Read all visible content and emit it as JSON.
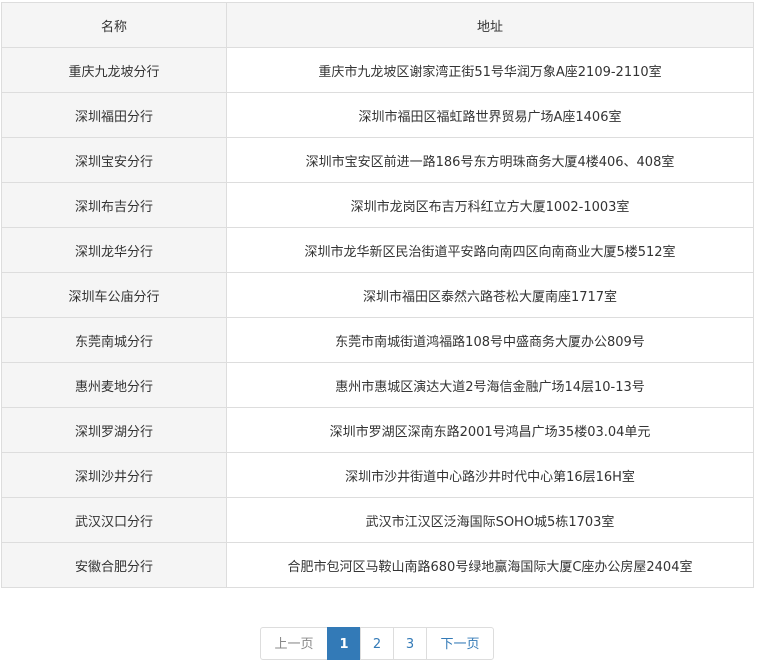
{
  "table": {
    "headers": {
      "name": "名称",
      "address": "地址"
    },
    "rows": [
      {
        "name": "重庆九龙坡分行",
        "address": "重庆市九龙坡区谢家湾正街51号华润万象A座2109-2110室"
      },
      {
        "name": "深圳福田分行",
        "address": "深圳市福田区福虹路世界贸易广场A座1406室"
      },
      {
        "name": "深圳宝安分行",
        "address": "深圳市宝安区前进一路186号东方明珠商务大厦4楼406、408室"
      },
      {
        "name": "深圳布吉分行",
        "address": "深圳市龙岗区布吉万科红立方大厦1002-1003室"
      },
      {
        "name": "深圳龙华分行",
        "address": "深圳市龙华新区民治街道平安路向南四区向南商业大厦5楼512室"
      },
      {
        "name": "深圳车公庙分行",
        "address": "深圳市福田区泰然六路苍松大厦南座1717室"
      },
      {
        "name": "东莞南城分行",
        "address": "东莞市南城街道鸿福路108号中盛商务大厦办公809号"
      },
      {
        "name": "惠州麦地分行",
        "address": "惠州市惠城区演达大道2号海信金融广场14层10-13号"
      },
      {
        "name": "深圳罗湖分行",
        "address": "深圳市罗湖区深南东路2001号鸿昌广场35楼03.04单元"
      },
      {
        "name": "深圳沙井分行",
        "address": "深圳市沙井街道中心路沙井时代中心第16层16H室"
      },
      {
        "name": "武汉汉口分行",
        "address": "武汉市江汉区泛海国际SOHO城5栋1703室"
      },
      {
        "name": "安徽合肥分行",
        "address": "合肥市包河区马鞍山南路680号绿地赢海国际大厦C座办公房屋2404室"
      }
    ]
  },
  "pagination": {
    "prev_label": "上一页",
    "next_label": "下一页",
    "pages": [
      "1",
      "2",
      "3"
    ],
    "current": "1",
    "active_color": "#337ab7"
  }
}
